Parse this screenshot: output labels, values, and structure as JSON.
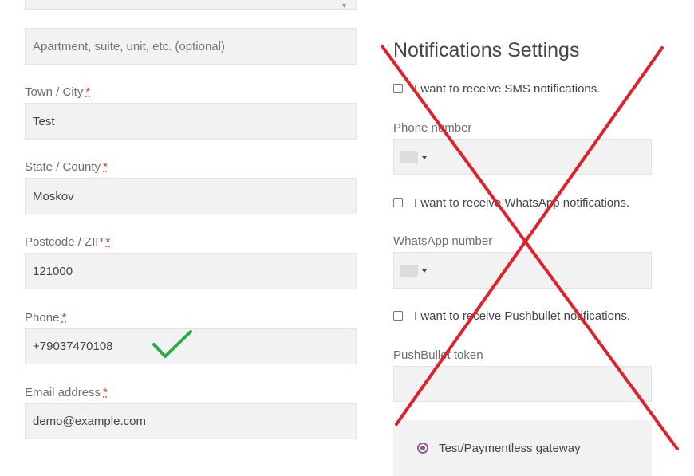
{
  "billing": {
    "address2": {
      "value": "",
      "placeholder": "Apartment, suite, unit, etc. (optional)"
    },
    "city": {
      "label": "Town / City",
      "required": "*",
      "value": "Test"
    },
    "state": {
      "label": "State / County",
      "required": "*",
      "value": "Moskov"
    },
    "postcode": {
      "label": "Postcode / ZIP",
      "required": "*",
      "value": "121000"
    },
    "phone": {
      "label": "Phone",
      "required": "*",
      "value": "+79037470108"
    },
    "email": {
      "label": "Email address",
      "required": "*",
      "value": "demo@example.com"
    }
  },
  "notifications": {
    "title": "Notifications Settings",
    "sms": {
      "checkbox_label": "I want to receive SMS notifications.",
      "number_label": "Phone number"
    },
    "whatsapp": {
      "checkbox_label": "I want to receive WhatsApp notifications.",
      "number_label": "WhatsApp number"
    },
    "pushbullet": {
      "checkbox_label": "I want to receive Pushbullet notifications.",
      "token_label": "PushBullet token"
    }
  },
  "payment": {
    "gateway_label": "Test/Paymentless gateway"
  },
  "annotations": {
    "checkmark_color": "#2eaa4a",
    "cross_color": "#e0202a"
  }
}
